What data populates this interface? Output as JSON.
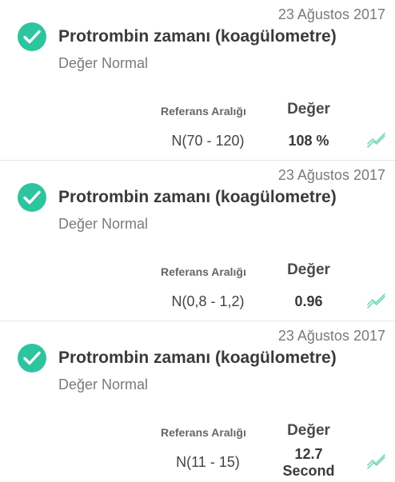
{
  "results": [
    {
      "date": "23 Ağustos 2017",
      "title": "Protrombin zamanı (koagülometre)",
      "status": "Değer Normal",
      "ref_label": "Referans Aralığı",
      "value_label": "Değer",
      "ref_range": "N(70 - 120)",
      "value": "108 %",
      "unit": ""
    },
    {
      "date": "23 Ağustos 2017",
      "title": "Protrombin zamanı (koagülometre)",
      "status": "Değer Normal",
      "ref_label": "Referans Aralığı",
      "value_label": "Değer",
      "ref_range": "N(0,8 - 1,2)",
      "value": "0.96",
      "unit": ""
    },
    {
      "date": "23 Ağustos 2017",
      "title": "Protrombin zamanı (koagülometre)",
      "status": "Değer Normal",
      "ref_label": "Referans Aralığı",
      "value_label": "Değer",
      "ref_range": "N(11 - 15)",
      "value": "12.7",
      "unit": "Second"
    }
  ],
  "colors": {
    "accent": "#2ec4a0",
    "trend": "#7bd6bd"
  },
  "icons": {
    "status": "check-circle-icon",
    "trend": "trend-chart-icon"
  }
}
